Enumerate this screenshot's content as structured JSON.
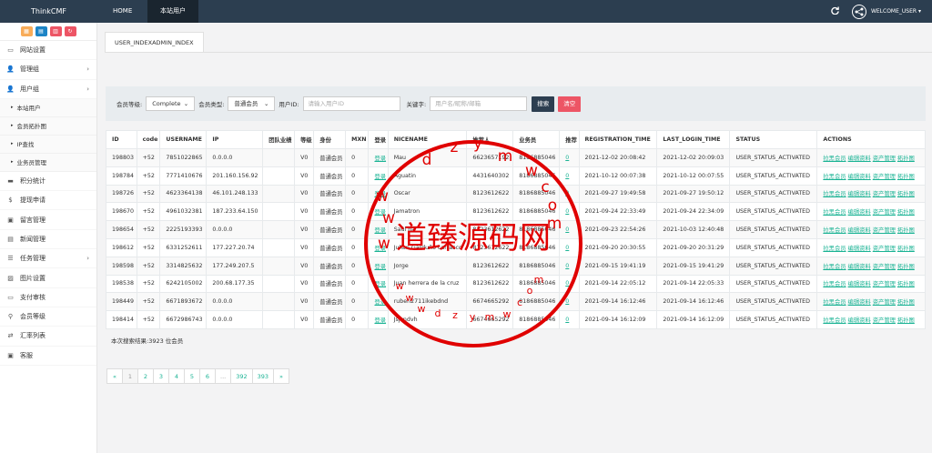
{
  "brand": "ThinkCMF",
  "nav": {
    "home": "HOME",
    "current": "本站用户"
  },
  "header": {
    "welcome": "WELCOME_USER"
  },
  "colors": {
    "topbar": "#2c3e50",
    "accent": "#1ab394",
    "search": "#2c3e50",
    "clear": "#ed5565",
    "stamp": "#e00000"
  },
  "quick_buttons": [
    {
      "icon": "grid-icon",
      "color": "#f8ac59"
    },
    {
      "icon": "file-icon",
      "color": "#1c84c6"
    },
    {
      "icon": "trash-icon",
      "color": "#ed5565"
    },
    {
      "icon": "recycle-icon",
      "color": "#ed5565"
    }
  ],
  "sidebar": {
    "items": [
      {
        "label": "网站设置",
        "icon": "monitor-icon",
        "arrow": false
      },
      {
        "label": "管理组",
        "icon": "user-icon",
        "arrow": true
      },
      {
        "label": "用户组",
        "icon": "user-icon",
        "arrow": true
      },
      {
        "label": "本站用户",
        "sub": true
      },
      {
        "label": "会员拓扑图",
        "sub": true
      },
      {
        "label": "IP查找",
        "sub": true
      },
      {
        "label": "业务员管理",
        "sub": true
      },
      {
        "label": "积分统计",
        "icon": "visa-icon",
        "arrow": false
      },
      {
        "label": "提现申请",
        "icon": "dollar-icon",
        "arrow": false
      },
      {
        "label": "留言管理",
        "icon": "comment-icon",
        "arrow": false
      },
      {
        "label": "新闻管理",
        "icon": "newspaper-icon",
        "arrow": false
      },
      {
        "label": "任务管理",
        "icon": "list-icon",
        "arrow": true
      },
      {
        "label": "图片设置",
        "icon": "image-icon",
        "arrow": false
      },
      {
        "label": "支付审核",
        "icon": "card-icon",
        "arrow": false
      },
      {
        "label": "会员等级",
        "icon": "vine-icon",
        "arrow": false
      },
      {
        "label": "汇率列表",
        "icon": "exchange-icon",
        "arrow": false
      },
      {
        "label": "客服",
        "icon": "chat-icon",
        "arrow": false
      }
    ]
  },
  "tab": {
    "label": "USER_INDEXADMIN_INDEX"
  },
  "filter": {
    "level_label": "会员等级:",
    "level_value": "Complete",
    "type_label": "会员类型:",
    "type_value": "普通会员",
    "uid_label": "用户ID:",
    "uid_placeholder": "请输入用户ID",
    "keyword_label": "关键字:",
    "keyword_placeholder": "用户名/昵称/邮箱",
    "search_label": "搜索",
    "clear_label": "清空"
  },
  "table": {
    "headers": [
      "ID",
      "code",
      "USERNAME",
      "IP",
      "团队业绩",
      "等级",
      "身份",
      "MXN",
      "登录",
      "NICENAME",
      "推荐人",
      "业务员",
      "推荐",
      "REGISTRATION_TIME",
      "LAST_LOGIN_TIME",
      "STATUS",
      "ACTIONS"
    ],
    "rows": [
      [
        "198803",
        "+52",
        "7851022865",
        "0.0.0.0",
        "",
        "V0",
        "普通会员",
        "0",
        "登录",
        "Mau",
        "6623657192",
        "8186885046",
        "0",
        "2021-12-02 20:08:42",
        "2021-12-02 20:09:03",
        "USER_STATUS_ACTIVATED"
      ],
      [
        "198784",
        "+52",
        "7771410676",
        "201.160.156.92",
        "",
        "V0",
        "普通会员",
        "0",
        "登录",
        "Aguatin",
        "4431640302",
        "8186885046",
        "0",
        "2021-10-12 00:07:38",
        "2021-10-12 00:07:55",
        "USER_STATUS_ACTIVATED"
      ],
      [
        "198726",
        "+52",
        "4623364138",
        "46.101.248.133",
        "",
        "V0",
        "普通会员",
        "0",
        "登录",
        "Oscar",
        "8123612622",
        "8186885046",
        "0",
        "2021-09-27 19:49:58",
        "2021-09-27 19:50:12",
        "USER_STATUS_ACTIVATED"
      ],
      [
        "198670",
        "+52",
        "4961032381",
        "187.233.64.150",
        "",
        "V0",
        "普通会员",
        "0",
        "登录",
        "Jamatron",
        "8123612622",
        "8186885046",
        "0",
        "2021-09-24 22:33:49",
        "2021-09-24 22:34:09",
        "USER_STATUS_ACTIVATED"
      ],
      [
        "198654",
        "+52",
        "2225193393",
        "0.0.0.0",
        "",
        "V0",
        "普通会员",
        "0",
        "登录",
        "Saúl ha",
        "8123612622",
        "8186885046",
        "0",
        "2021-09-23 22:54:26",
        "2021-10-03 12:40:48",
        "USER_STATUS_ACTIVATED"
      ],
      [
        "198612",
        "+52",
        "6331252611",
        "177.227.20.74",
        "",
        "V0",
        "普通会员",
        "0",
        "登录",
        "Julian Garduño carrasco",
        "8123612622",
        "8186885046",
        "0",
        "2021-09-20 20:30:55",
        "2021-09-20 20:31:29",
        "USER_STATUS_ACTIVATED"
      ],
      [
        "198598",
        "+52",
        "3314825632",
        "177.249.207.5",
        "",
        "V0",
        "普通会员",
        "0",
        "登录",
        "Jorge",
        "8123612622",
        "8186885046",
        "0",
        "2021-09-15 19:41:19",
        "2021-09-15 19:41:29",
        "USER_STATUS_ACTIVATED"
      ],
      [
        "198538",
        "+52",
        "6242105002",
        "200.68.177.35",
        "",
        "V0",
        "普通会员",
        "0",
        "登录",
        "Juan herrera de la cruz",
        "8123612622",
        "8186885046",
        "0",
        "2021-09-14 22:05:12",
        "2021-09-14 22:05:33",
        "USER_STATUS_ACTIVATED"
      ],
      [
        "198449",
        "+52",
        "6671893672",
        "0.0.0.0",
        "",
        "V0",
        "普通会员",
        "0",
        "登录",
        "ruben2711ikebdnd",
        "6674665292",
        "8186885046",
        "0",
        "2021-09-14 16:12:46",
        "2021-09-14 16:12:46",
        "USER_STATUS_ACTIVATED"
      ],
      [
        "198414",
        "+52",
        "6672986743",
        "0.0.0.0",
        "",
        "V0",
        "普通会员",
        "0",
        "登录",
        "Jsjsndvh",
        "6674665292",
        "8186885046",
        "0",
        "2021-09-14 16:12:09",
        "2021-09-14 16:12:09",
        "USER_STATUS_ACTIVATED"
      ]
    ],
    "actions": [
      "拉黑会员",
      "编辑资料",
      "资产管理",
      "拓扑图"
    ]
  },
  "summary": "本次搜索结果:3923 位会员",
  "pagination": [
    "«",
    "1",
    "2",
    "3",
    "4",
    "5",
    "6",
    "...",
    "392",
    "393",
    "»"
  ],
  "watermark": {
    "text": "道臻源码网",
    "url": "w w w . d z y m w . c o m"
  }
}
